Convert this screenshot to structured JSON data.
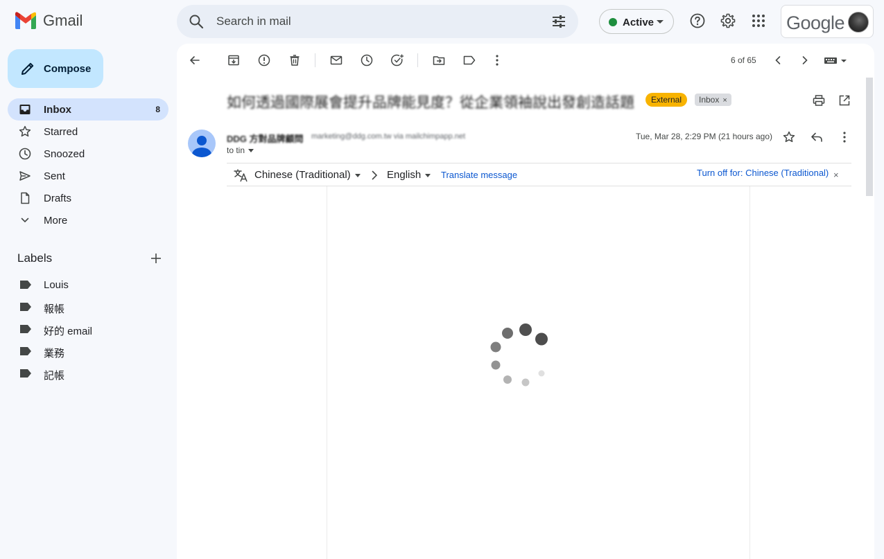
{
  "app": {
    "name": "Gmail"
  },
  "search": {
    "placeholder": "Search in mail"
  },
  "status": {
    "label": "Active",
    "color": "#1e8e3e"
  },
  "account": {
    "brand": "Google"
  },
  "compose": {
    "label": "Compose"
  },
  "nav": [
    {
      "label": "Inbox",
      "count": "8",
      "icon": "inbox-icon",
      "active": true
    },
    {
      "label": "Starred",
      "count": "",
      "icon": "star-icon"
    },
    {
      "label": "Snoozed",
      "count": "",
      "icon": "clock-icon"
    },
    {
      "label": "Sent",
      "count": "",
      "icon": "send-icon"
    },
    {
      "label": "Drafts",
      "count": "",
      "icon": "file-icon"
    },
    {
      "label": "More",
      "count": "",
      "icon": "chevron-down-icon"
    }
  ],
  "labels": {
    "title": "Labels",
    "items": [
      "Louis",
      "報帳",
      "好的 email",
      "業務",
      "記帳"
    ]
  },
  "toolbar": {
    "pager": "6 of 65"
  },
  "message": {
    "subject": "如何透過國際展會提升品牌能見度？從企業領袖說出發創造話題",
    "tags": {
      "external": "External",
      "inbox": "Inbox",
      "inbox_remove": "×"
    },
    "sender_name": "DDG 方對品牌顧問",
    "sender_email": "marketing@ddg.com.tw via mailchimpapp.net",
    "to": "to tin",
    "date": "Tue, Mar 28, 2:29 PM (21 hours ago)"
  },
  "translate": {
    "from": "Chinese (Traditional)",
    "to": "English",
    "link": "Translate message",
    "turn_off": "Turn off for: Chinese (Traditional)",
    "close": "×"
  },
  "colors": {
    "accent": "#0b57d0",
    "compose_bg": "#c2e7ff",
    "active_nav": "#d3e3fd",
    "external_tag": "#f8b300"
  }
}
